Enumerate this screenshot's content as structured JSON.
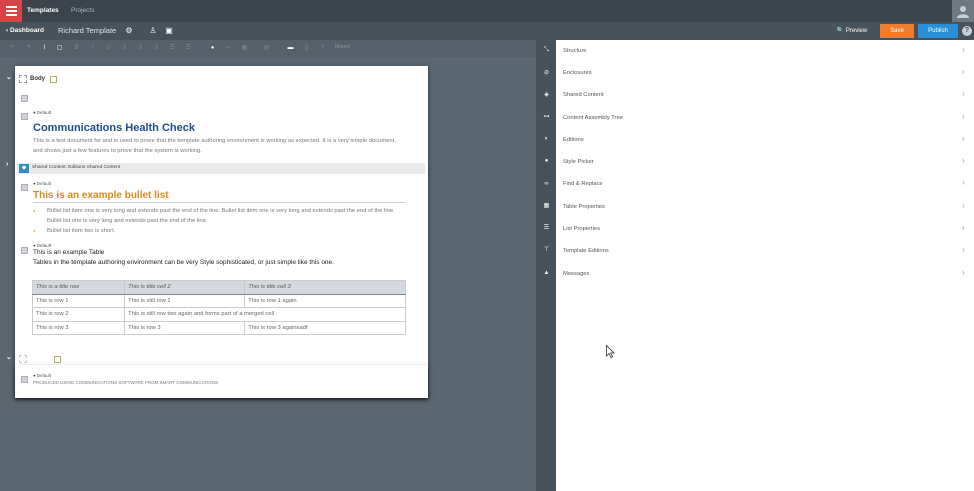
{
  "topbar": {
    "tabs": [
      {
        "label": "Templates"
      },
      {
        "label": "Projects"
      }
    ]
  },
  "secondbar": {
    "back_label": "Dashboard",
    "document_title": "Richard Template",
    "preview_label": "Preview",
    "save_label": "Save",
    "publish_label": "Publish",
    "help_label": "?"
  },
  "toolbar": {
    "style_dropdown": "Mixed"
  },
  "document": {
    "body_label": "Body",
    "footer_label": "Footer",
    "default_tag": "Default",
    "heading": "Communications Health Check",
    "intro": "This is a test document for and is used to prove that the template authoring environment is working as expected. It is a very simple document, and shows just a few features to prove that the system is working.",
    "shared_content_label": "Shared Content: Editions Shared Content",
    "bullet_heading": "This is an example bullet list",
    "bullets": [
      "Bullet list item one is very long and extends past the end of the line. Bullet list item one is very long and extends past the end of the line. Bullet list one is very long and extends past the end of the line.",
      "Bullet list item two is short."
    ],
    "table_title": "This is an example Table",
    "table_desc": "Tables in the template authoring environment can be very Style sophisticated, or just simple like this one.",
    "table": {
      "headers": [
        "This is a title row",
        "This is title cell 2",
        "This is title cell 3"
      ],
      "rows": [
        [
          "This is row 1",
          "This is still row 1",
          "This is row 1 again"
        ],
        [
          "This is row 2",
          "This is still row two again and forms part of a merged cell",
          ""
        ],
        [
          "This is row 3",
          "This is row 3",
          "This is row 3 againsadf"
        ]
      ]
    },
    "footer_text": "PRODUCED USING COMMUNICATIONS SOFTWARE FROM SMART COMMUNICATIONS"
  },
  "panel": {
    "items": [
      {
        "label": "Structure",
        "icon": "structure-icon"
      },
      {
        "label": "Enclosures",
        "icon": "paperclip-icon"
      },
      {
        "label": "Shared Content",
        "icon": "layers-icon"
      },
      {
        "label": "Content Assembly Tree",
        "icon": "tree-icon"
      },
      {
        "label": "Editions",
        "icon": "editions-icon"
      },
      {
        "label": "Style Picker",
        "icon": "palette-icon"
      },
      {
        "label": "Find & Replace",
        "icon": "binoculars-icon"
      },
      {
        "label": "Table Properties",
        "icon": "table-icon"
      },
      {
        "label": "List Properties",
        "icon": "list-icon"
      },
      {
        "label": "Template Editions",
        "icon": "template-editions-icon"
      },
      {
        "label": "Messages",
        "icon": "warning-icon"
      }
    ]
  },
  "colors": {
    "accent_red": "#d64545",
    "save_orange": "#f07c2e",
    "publish_blue": "#2a8fd6",
    "heading_blue": "#1f4e8c",
    "heading_orange": "#d88a1a"
  }
}
